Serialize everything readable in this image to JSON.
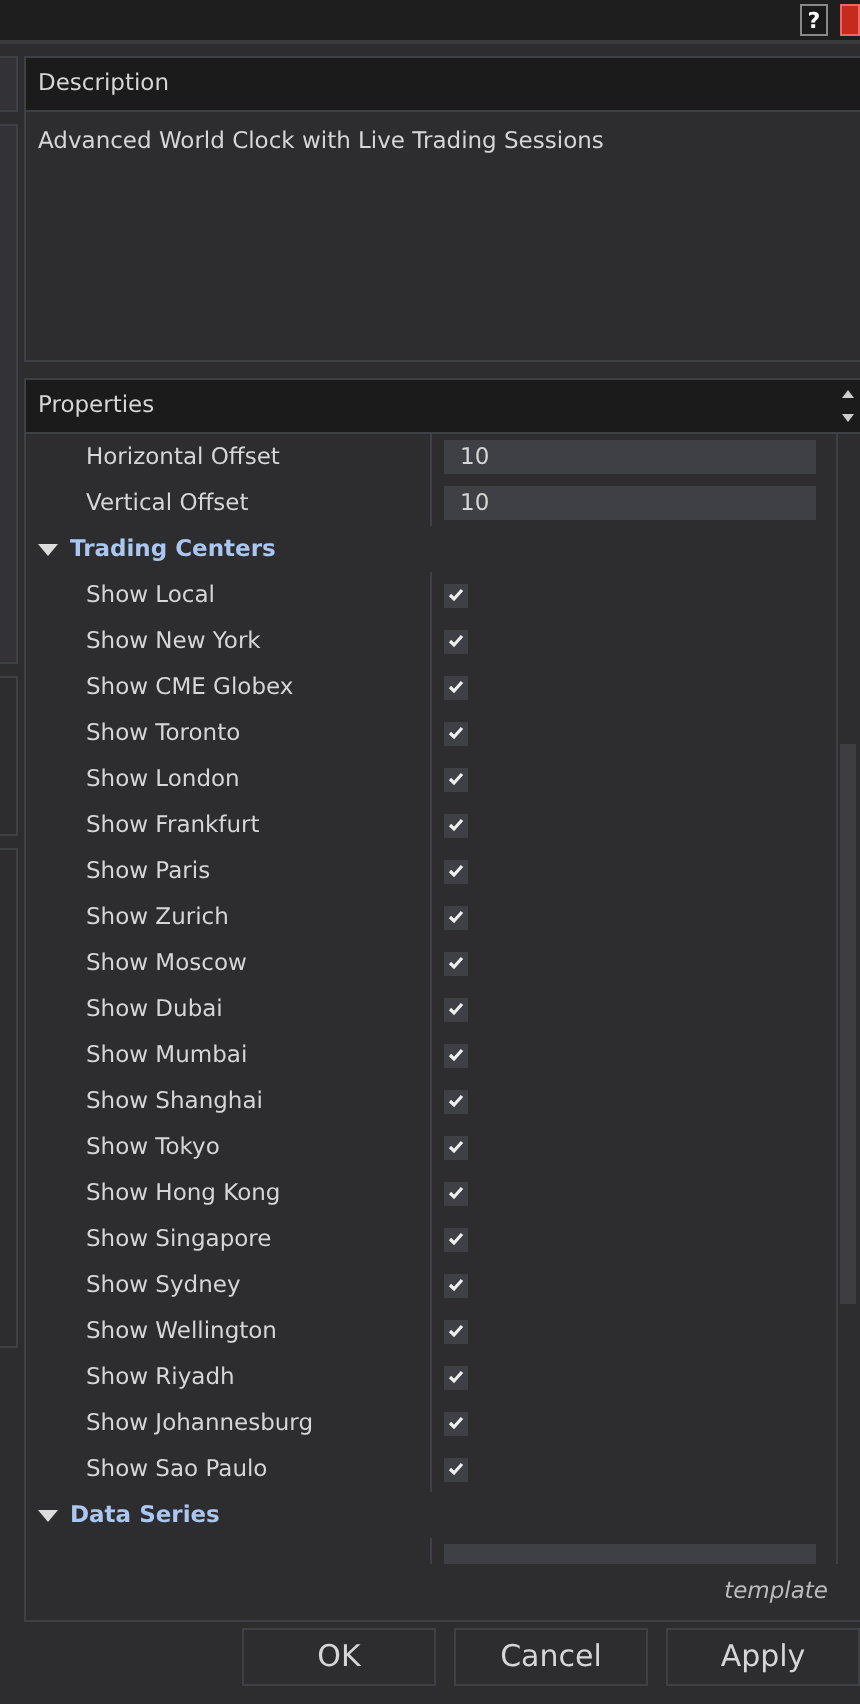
{
  "title_bar": {
    "help_button": "?"
  },
  "description": {
    "header": "Description",
    "text": "Advanced World Clock with Live Trading Sessions"
  },
  "properties": {
    "header": "Properties",
    "rows": [
      {
        "kind": "number",
        "label": "Horizontal Offset",
        "value": "10"
      },
      {
        "kind": "number",
        "label": "Vertical Offset",
        "value": "10"
      },
      {
        "kind": "category",
        "label": "Trading Centers",
        "expanded": true
      },
      {
        "kind": "checkbox",
        "label": "Show Local",
        "checked": true
      },
      {
        "kind": "checkbox",
        "label": "Show New York",
        "checked": true
      },
      {
        "kind": "checkbox",
        "label": "Show CME Globex",
        "checked": true
      },
      {
        "kind": "checkbox",
        "label": "Show Toronto",
        "checked": true
      },
      {
        "kind": "checkbox",
        "label": "Show London",
        "checked": true
      },
      {
        "kind": "checkbox",
        "label": "Show Frankfurt",
        "checked": true
      },
      {
        "kind": "checkbox",
        "label": "Show Paris",
        "checked": true
      },
      {
        "kind": "checkbox",
        "label": "Show Zurich",
        "checked": true
      },
      {
        "kind": "checkbox",
        "label": "Show Moscow",
        "checked": true
      },
      {
        "kind": "checkbox",
        "label": "Show Dubai",
        "checked": true
      },
      {
        "kind": "checkbox",
        "label": "Show Mumbai",
        "checked": true
      },
      {
        "kind": "checkbox",
        "label": "Show Shanghai",
        "checked": true
      },
      {
        "kind": "checkbox",
        "label": "Show Tokyo",
        "checked": true
      },
      {
        "kind": "checkbox",
        "label": "Show Hong Kong",
        "checked": true
      },
      {
        "kind": "checkbox",
        "label": "Show Singapore",
        "checked": true
      },
      {
        "kind": "checkbox",
        "label": "Show Sydney",
        "checked": true
      },
      {
        "kind": "checkbox",
        "label": "Show Wellington",
        "checked": true
      },
      {
        "kind": "checkbox",
        "label": "Show Riyadh",
        "checked": true
      },
      {
        "kind": "checkbox",
        "label": "Show Johannesburg",
        "checked": true
      },
      {
        "kind": "checkbox",
        "label": "Show Sao Paulo",
        "checked": true
      },
      {
        "kind": "category",
        "label": "Data Series",
        "expanded": true
      },
      {
        "kind": "partial"
      }
    ],
    "footer": "template"
  },
  "buttons": [
    "OK",
    "Cancel",
    "Apply"
  ]
}
